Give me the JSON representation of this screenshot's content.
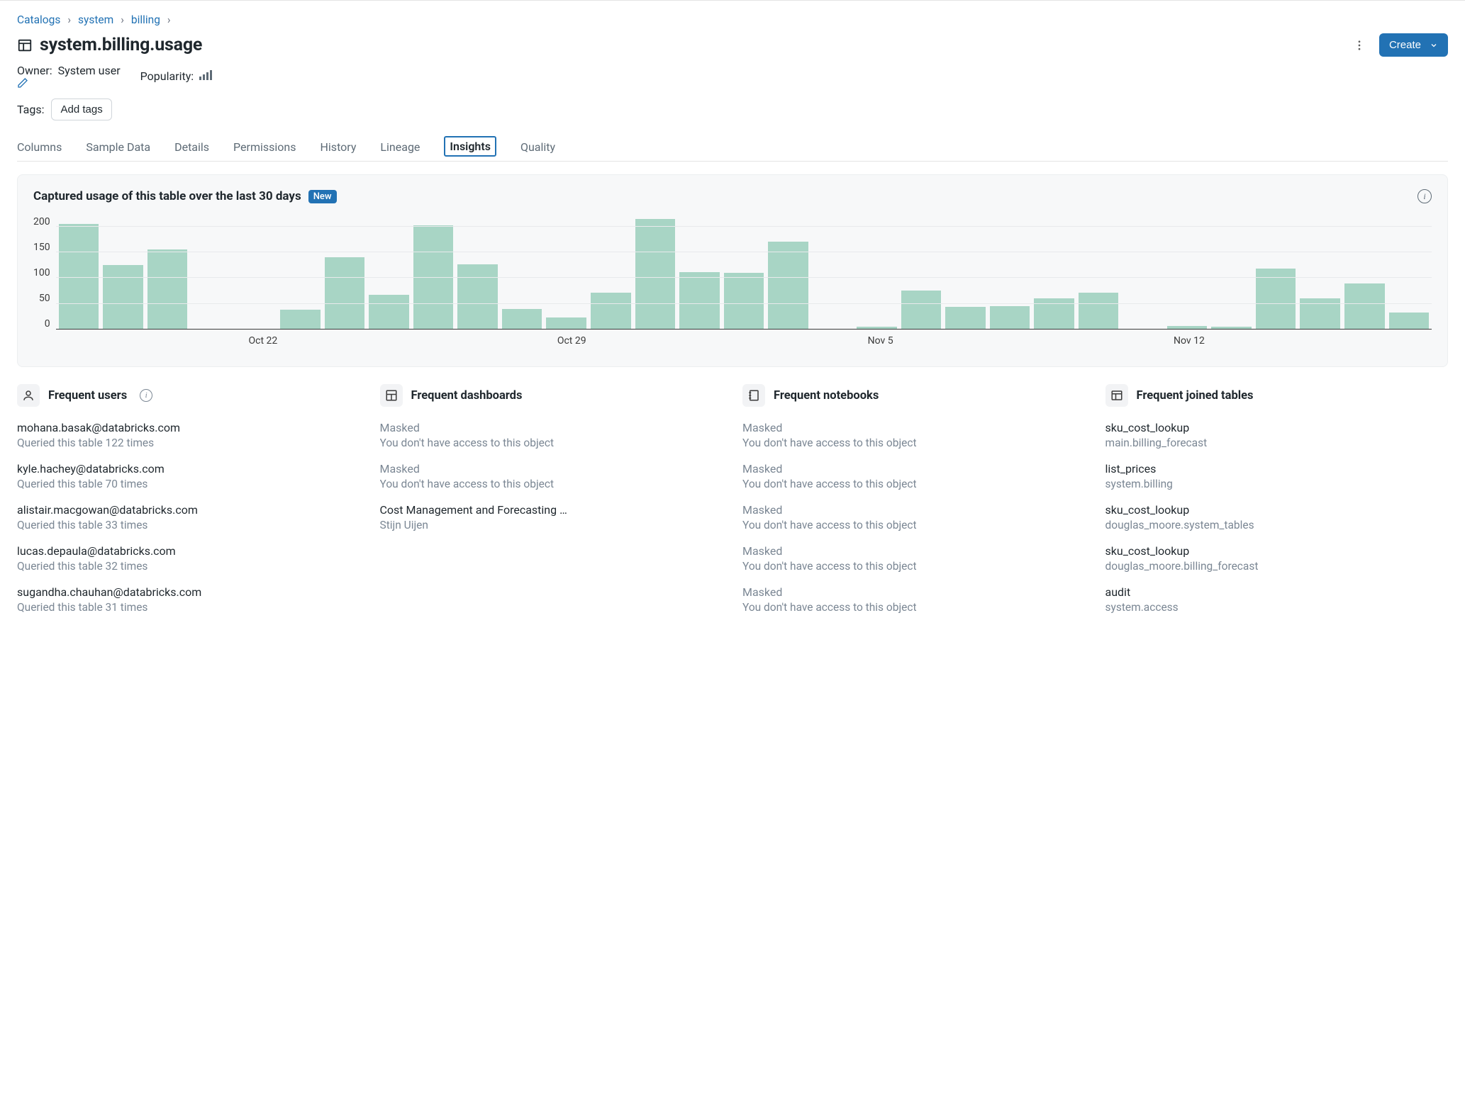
{
  "breadcrumbs": [
    "Catalogs",
    "system",
    "billing"
  ],
  "page_title": "system.billing.usage",
  "owner_label": "Owner:",
  "owner_value": "System user",
  "popularity_label": "Popularity:",
  "tags_label": "Tags:",
  "add_tags_label": "Add tags",
  "create_label": "Create",
  "tabs": [
    "Columns",
    "Sample Data",
    "Details",
    "Permissions",
    "History",
    "Lineage",
    "Insights",
    "Quality"
  ],
  "active_tab": "Insights",
  "panel_title": "Captured usage of this table over the last 30 days",
  "new_badge": "New",
  "chart_data": {
    "type": "bar",
    "ylabel": "",
    "xlabel": "",
    "ylim": [
      0,
      220
    ],
    "y_ticks": [
      0,
      50,
      100,
      150,
      200
    ],
    "x_ticks": [
      {
        "label": "Oct 22",
        "index": 4
      },
      {
        "label": "Oct 29",
        "index": 11
      },
      {
        "label": "Nov 5",
        "index": 18
      },
      {
        "label": "Nov 12",
        "index": 25
      }
    ],
    "values": [
      205,
      125,
      155,
      0,
      0,
      38,
      140,
      68,
      202,
      127,
      40,
      24,
      72,
      215,
      112,
      110,
      170,
      0,
      5,
      75,
      44,
      45,
      60,
      72,
      0,
      7,
      5,
      118,
      60,
      90,
      33
    ]
  },
  "cards": {
    "users": {
      "title": "Frequent users",
      "entries": [
        {
          "primary": "mohana.basak@databricks.com",
          "secondary": "Queried this table 122 times"
        },
        {
          "primary": "kyle.hachey@databricks.com",
          "secondary": "Queried this table 70 times"
        },
        {
          "primary": "alistair.macgowan@databricks.com",
          "secondary": "Queried this table 33 times"
        },
        {
          "primary": "lucas.depaula@databricks.com",
          "secondary": "Queried this table 32 times"
        },
        {
          "primary": "sugandha.chauhan@databricks.com",
          "secondary": "Queried this table 31 times"
        }
      ]
    },
    "dashboards": {
      "title": "Frequent dashboards",
      "entries": [
        {
          "primary": "Masked",
          "secondary": "You don't have access to this object",
          "masked": true
        },
        {
          "primary": "Masked",
          "secondary": "You don't have access to this object",
          "masked": true
        },
        {
          "primary": "Cost Management and Forecasting …",
          "secondary": "Stijn Uijen"
        }
      ]
    },
    "notebooks": {
      "title": "Frequent notebooks",
      "entries": [
        {
          "primary": "Masked",
          "secondary": "You don't have access to this object",
          "masked": true
        },
        {
          "primary": "Masked",
          "secondary": "You don't have access to this object",
          "masked": true
        },
        {
          "primary": "Masked",
          "secondary": "You don't have access to this object",
          "masked": true
        },
        {
          "primary": "Masked",
          "secondary": "You don't have access to this object",
          "masked": true
        },
        {
          "primary": "Masked",
          "secondary": "You don't have access to this object",
          "masked": true
        }
      ]
    },
    "joined": {
      "title": "Frequent joined tables",
      "entries": [
        {
          "primary": "sku_cost_lookup",
          "secondary": "main.billing_forecast"
        },
        {
          "primary": "list_prices",
          "secondary": "system.billing"
        },
        {
          "primary": "sku_cost_lookup",
          "secondary": "douglas_moore.system_tables"
        },
        {
          "primary": "sku_cost_lookup",
          "secondary": "douglas_moore.billing_forecast"
        },
        {
          "primary": "audit",
          "secondary": "system.access"
        }
      ]
    }
  }
}
